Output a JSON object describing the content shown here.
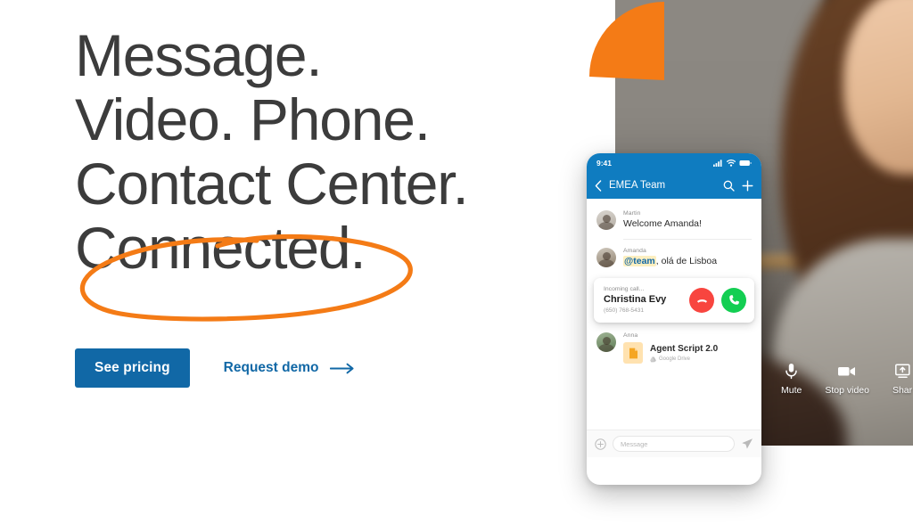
{
  "hero": {
    "headline": "Message.\nVideo. Phone.\nContact Center.\nConnected.",
    "primary_cta": "See pricing",
    "secondary_cta": "Request demo",
    "arrow_icon": "arrow-right-icon",
    "highlight_annotation": "hand-drawn-circle"
  },
  "colors": {
    "brand_blue": "#1168a6",
    "app_blue": "#0f7cc0",
    "accent_orange": "#f47b16",
    "headline_gray": "#3c3c3c",
    "decline_red": "#f8453f",
    "accept_green": "#13ce52",
    "mention_highlight": "#fdefc0"
  },
  "video_call": {
    "controls": [
      {
        "label": "Mute",
        "icon": "microphone-icon"
      },
      {
        "label": "Stop video",
        "icon": "video-camera-icon"
      },
      {
        "label": "Shar",
        "icon": "share-screen-icon"
      }
    ]
  },
  "phone": {
    "status_bar": {
      "time": "9:41",
      "icons": [
        "cellular-signal-icon",
        "wifi-icon",
        "battery-icon"
      ]
    },
    "app_bar": {
      "back_icon": "chevron-left-icon",
      "title": "EMEA Team",
      "search_icon": "search-icon",
      "add_icon": "plus-icon"
    },
    "messages": [
      {
        "author": "Martin",
        "text": "Welcome Amanda!",
        "avatar": "avatar-martin"
      },
      {
        "author": "Amanda",
        "mention": "@team",
        "text": ", olá de Lisboa",
        "avatar": "avatar-amanda"
      }
    ],
    "incoming_call": {
      "label": "Incoming call...",
      "name": "Christina Evy",
      "number": "(650) 768-5431",
      "decline_icon": "phone-hangup-icon",
      "accept_icon": "phone-answer-icon"
    },
    "file_message": {
      "author": "Anna",
      "avatar": "avatar-anna",
      "file_name": "Agent Script 2.0",
      "file_source": "Google Drive",
      "file_icon": "document-icon",
      "source_icon": "google-drive-icon"
    },
    "composer": {
      "attach_icon": "plus-circle-icon",
      "placeholder": "Message",
      "value": "",
      "send_icon": "send-icon"
    }
  }
}
